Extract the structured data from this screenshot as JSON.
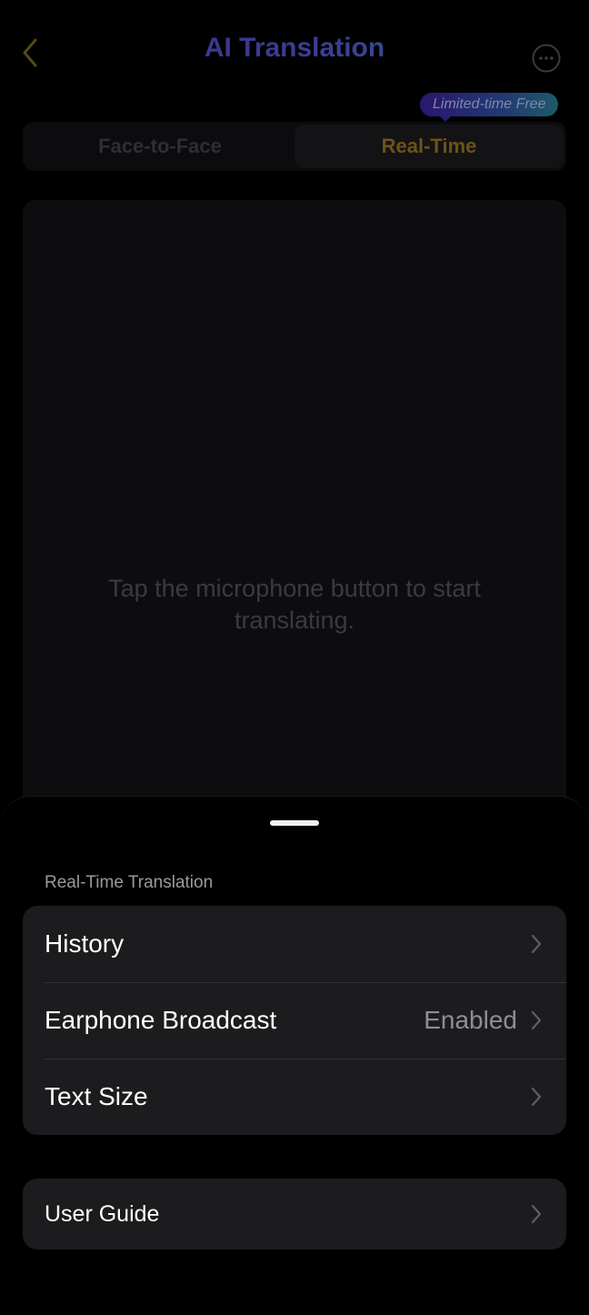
{
  "header": {
    "title": "AI Translation",
    "back_icon": "chevron-left-icon",
    "more_icon": "ellipsis-circle-icon"
  },
  "promo": {
    "badge": "Limited-time Free"
  },
  "mode_tabs": [
    {
      "label": "Face-to-Face",
      "selected": false
    },
    {
      "label": "Real-Time",
      "selected": true
    }
  ],
  "main": {
    "hint": "Tap the microphone button to start translating."
  },
  "sheet": {
    "section_title": "Real-Time Translation",
    "items": [
      {
        "label": "History",
        "value": "",
        "icon": "chevron-right-icon"
      },
      {
        "label": "Earphone Broadcast",
        "value": "Enabled",
        "icon": "chevron-right-icon"
      },
      {
        "label": "Text Size",
        "value": "",
        "icon": "chevron-right-icon"
      }
    ],
    "guide": {
      "label": "User Guide",
      "icon": "chevron-right-icon"
    }
  },
  "colors": {
    "background": "#000000",
    "card": "#1c1c1e",
    "active_tab_text": "#6b5418",
    "secondary_text": "#8e8e93"
  }
}
